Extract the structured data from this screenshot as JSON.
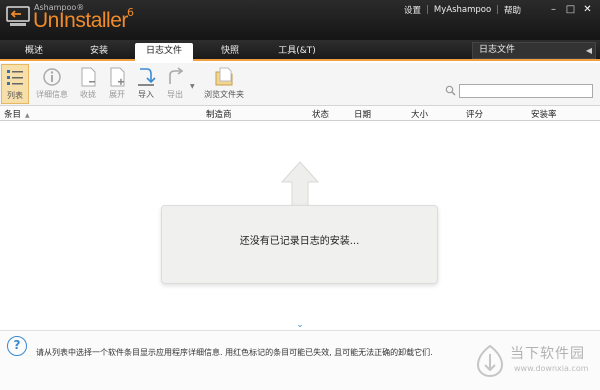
{
  "app": {
    "brand_small": "Ashampoo®",
    "brand_name": "UnInstaller",
    "brand_version": "6"
  },
  "top_links": [
    "设置",
    "MyAshampoo",
    "帮助"
  ],
  "window_buttons": [
    "–",
    "□",
    "✕"
  ],
  "tabs": [
    {
      "label": "概述"
    },
    {
      "label": "安装"
    },
    {
      "label": "日志文件"
    },
    {
      "label": "快照"
    },
    {
      "label": "工具(&T)"
    }
  ],
  "active_tab": "日志文件",
  "right_panel_title": "日志文件",
  "toolbar": [
    {
      "label": "列表",
      "icon": "list-icon"
    },
    {
      "label": "详细信息",
      "icon": "info-icon"
    },
    {
      "label": "收拢",
      "icon": "collapse-icon"
    },
    {
      "label": "展开",
      "icon": "expand-icon"
    },
    {
      "label": "导入",
      "icon": "import-icon"
    },
    {
      "label": "导出",
      "icon": "export-icon"
    },
    {
      "label": "浏览文件夹",
      "icon": "folder-icon"
    }
  ],
  "search": {
    "value": ""
  },
  "columns": [
    "条目",
    "制造商",
    "状态",
    "日期",
    "大小",
    "评分",
    "安装率"
  ],
  "empty_message": "还没有已记录日志的安装...",
  "help_text": "请从列表中选择一个软件条目显示应用程序详细信息. 用红色标记的条目可能已失效, 且可能无法正确的卸载它们.",
  "watermark": {
    "name": "当下软件园",
    "url": "www.downxia.com"
  },
  "colors": {
    "accent": "#f08a2a",
    "tab_underline": "#f0a040",
    "toolbar_active": "#f7dfaa"
  }
}
